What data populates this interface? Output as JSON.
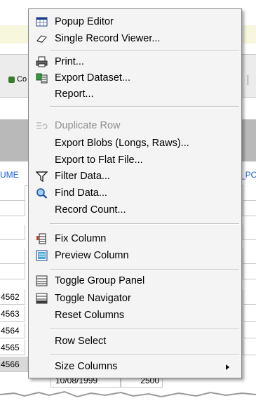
{
  "background": {
    "toolbar_fragment_left": "Co",
    "column_header_left": "UME",
    "column_header_right": "_PO",
    "row_ids": [
      "4562",
      "4563",
      "4564",
      "4565",
      "4566"
    ],
    "last_row_date": "10/08/1999",
    "last_row_value": "2500"
  },
  "menu": {
    "items": [
      {
        "label": "Popup Editor",
        "icon": "popup-editor-icon",
        "enabled": true
      },
      {
        "label": "Single Record Viewer...",
        "icon": "record-viewer-icon",
        "enabled": true
      },
      {
        "label": "Print...",
        "icon": "printer-icon",
        "enabled": true
      },
      {
        "label": "Export Dataset...",
        "icon": "export-dataset-icon",
        "enabled": true
      },
      {
        "label": "Report...",
        "icon": "",
        "enabled": true
      },
      {
        "label": "Duplicate Row",
        "icon": "duplicate-row-icon",
        "enabled": false
      },
      {
        "label": "Export Blobs (Longs, Raws)...",
        "icon": "",
        "enabled": true
      },
      {
        "label": "Export to Flat File...",
        "icon": "",
        "enabled": true
      },
      {
        "label": "Filter Data...",
        "icon": "filter-icon",
        "enabled": true
      },
      {
        "label": "Find Data...",
        "icon": "magnifier-icon",
        "enabled": true
      },
      {
        "label": "Record Count...",
        "icon": "",
        "enabled": true
      },
      {
        "label": "Fix Column",
        "icon": "fix-column-icon",
        "enabled": true
      },
      {
        "label": "Preview Column",
        "icon": "preview-column-icon",
        "enabled": true
      },
      {
        "label": "Toggle Group Panel",
        "icon": "group-panel-icon",
        "enabled": true
      },
      {
        "label": "Toggle Navigator",
        "icon": "navigator-icon",
        "enabled": true
      },
      {
        "label": "Reset Columns",
        "icon": "",
        "enabled": true
      },
      {
        "label": "Row Select",
        "icon": "",
        "enabled": true
      },
      {
        "label": "Size Columns",
        "icon": "",
        "enabled": true,
        "submenu": true
      }
    ]
  },
  "colors": {
    "menu_bg": "#f4f4f4",
    "header_blue": "#1a5fd1",
    "disabled_text": "#8f8f8f"
  }
}
